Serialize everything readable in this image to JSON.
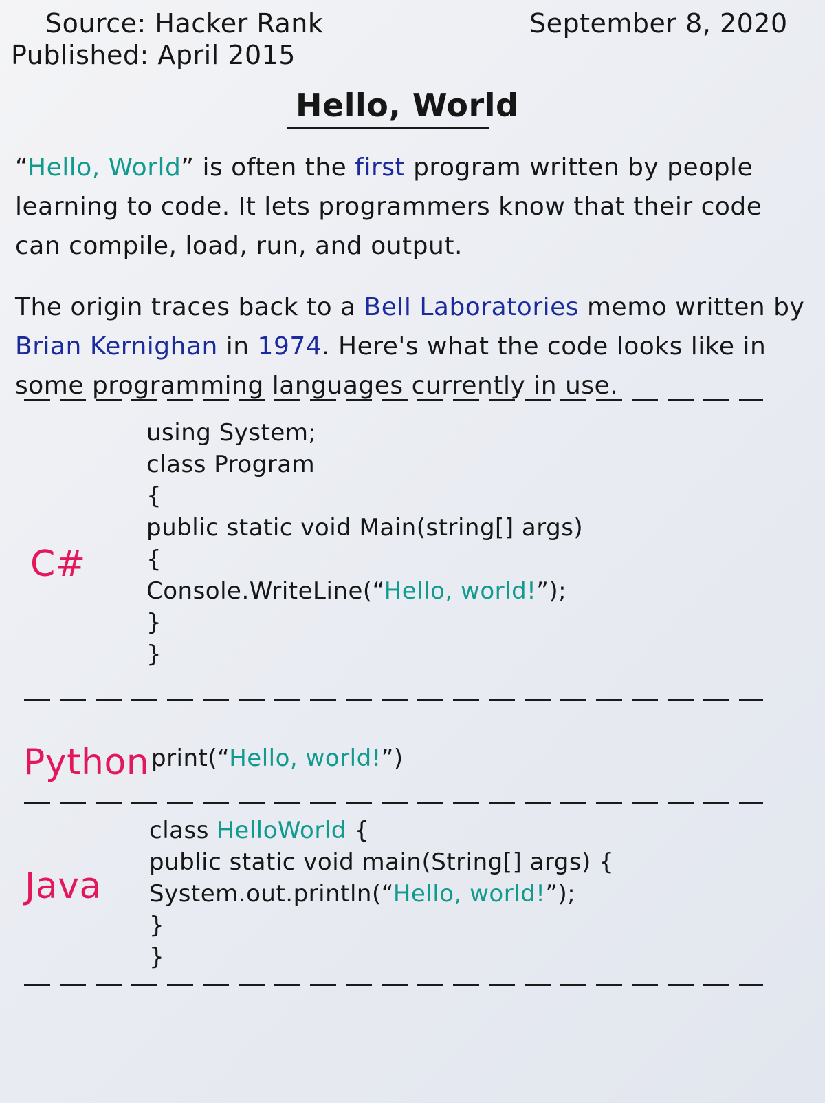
{
  "header": {
    "source": "Source: Hacker Rank",
    "published": "Published: April 2015",
    "date": "September 8, 2020"
  },
  "title": "Hello, World",
  "paragraph1": {
    "open_quote": "“",
    "hello_world": "Hello, World",
    "close_quote": "”",
    "text_a": " is often the ",
    "first": "first",
    "text_b": " program written by people learning to code. It lets programmers know that their code can compile, load, run, and output."
  },
  "paragraph2": {
    "text_a": "The origin traces back to a ",
    "bell_labs": "Bell Laboratories",
    "text_b": " memo written by ",
    "kernighan": "Brian Kernighan",
    "text_c": " in ",
    "year": "1974",
    "text_d": ". Here's what the code looks like in some programming languages currently in use."
  },
  "colors": {
    "teal": "#119a8e",
    "blue": "#1b2a9c",
    "red": "#e2185a"
  },
  "languages": [
    {
      "name": "C#",
      "lines": [
        {
          "plain": "using System;"
        },
        {
          "plain": "class Program"
        },
        {
          "plain": "{"
        },
        {
          "plain": "public static void Main(string[] args)"
        },
        {
          "plain": "{"
        },
        {
          "pre": "Console.WriteLine(“",
          "hl": "Hello, world!",
          "post": "”);"
        },
        {
          "plain": "}"
        },
        {
          "plain": "}"
        }
      ]
    },
    {
      "name": "Python",
      "lines": [
        {
          "pre": "print(“",
          "hl": "Hello, world!",
          "post": "”)"
        }
      ]
    },
    {
      "name": "Java",
      "lines": [
        {
          "pre": "class ",
          "hl": "HelloWorld",
          "post": " {"
        },
        {
          "plain": "public static void main(String[] args) {"
        },
        {
          "pre": "System.out.println(“",
          "hl": "Hello, world!",
          "post": "”);"
        },
        {
          "plain": "}"
        },
        {
          "plain": "}"
        }
      ]
    }
  ]
}
